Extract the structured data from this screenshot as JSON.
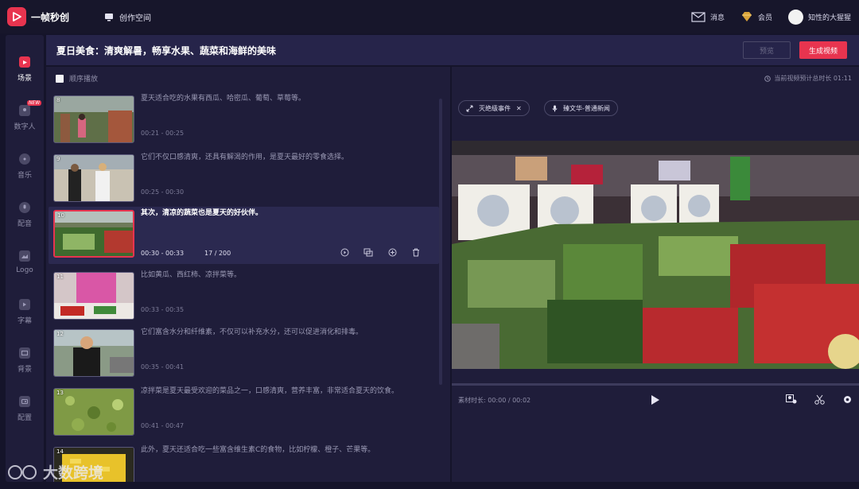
{
  "app": {
    "name": "一帧秒创",
    "create_space": "创作空间"
  },
  "topbar": {
    "messages": "消息",
    "member": "会员",
    "username": "知性的大猩猩"
  },
  "nav": [
    {
      "label": "场景",
      "icon": "scene-icon",
      "active": true
    },
    {
      "label": "数字人",
      "icon": "digital-human-icon",
      "badge": "NEW"
    },
    {
      "label": "音乐",
      "icon": "music-icon"
    },
    {
      "label": "配音",
      "icon": "dubbing-icon"
    },
    {
      "label": "Logo",
      "icon": "logo-icon"
    },
    {
      "label": "字幕",
      "icon": "subtitle-icon"
    },
    {
      "label": "背景",
      "icon": "background-icon"
    },
    {
      "label": "配置",
      "icon": "config-icon"
    }
  ],
  "header": {
    "title": "夏日美食：清爽解暑，畅享水果、蔬菜和海鲜的美味",
    "preview": "预览",
    "generate": "生成视频"
  },
  "scene_list": {
    "sequential": "顺序播放",
    "scenes": [
      {
        "num": "8",
        "text": "夏天适合吃的水果有西瓜、哈密瓜、葡萄、草莓等。",
        "time": "00:21 - 00:25"
      },
      {
        "num": "9",
        "text": "它们不仅口感清爽，还具有解渴的作用，是夏天最好的零食选择。",
        "time": "00:25 - 00:30"
      },
      {
        "num": "10",
        "text": "其次，清凉的蔬菜也是夏天的好伙伴。",
        "time": "00:30 - 00:33",
        "count": "17 / 200",
        "active": true
      },
      {
        "num": "11",
        "text": "比如黄瓜、西红柿、凉拌菜等。",
        "time": "00:33 - 00:35"
      },
      {
        "num": "12",
        "text": "它们富含水分和纤维素，不仅可以补充水分，还可以促进消化和排毒。",
        "time": "00:35 - 00:41"
      },
      {
        "num": "13",
        "text": "凉拌菜是夏天最受欢迎的菜品之一，口感清爽，营养丰富，非常适合夏天的饮食。",
        "time": "00:41 - 00:47"
      },
      {
        "num": "14",
        "text": "此外，夏天还适合吃一些富含维生素C的食物，比如柠檬、橙子、芒果等。",
        "time": ""
      }
    ]
  },
  "preview": {
    "duration": "当前视频预计总时长 01:11",
    "chip_effect": "灭绝级事件",
    "chip_voice": "臻文华-普通新闻",
    "material_length": "素材时长: 00:00 / 00:02"
  },
  "watermark": "大数跨境",
  "colors": {
    "accent": "#e8344f",
    "panel": "#1f1d3a",
    "header": "#26244a"
  }
}
